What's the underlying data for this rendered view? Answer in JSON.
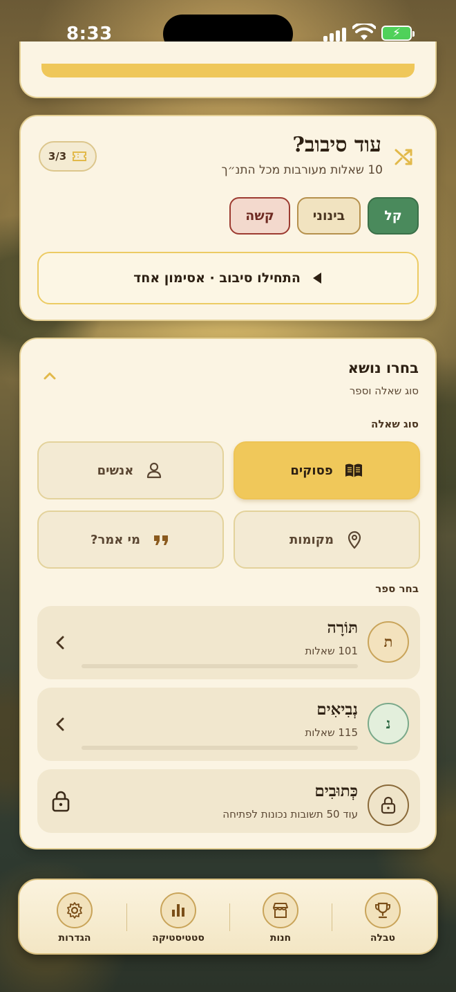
{
  "status_bar": {
    "time": "8:33"
  },
  "shuffle": {
    "title": "עוד סיבוב?",
    "subtitle": "10 שאלות מעורבות מכל התנ״ך",
    "tickets": "3/3",
    "difficulties": [
      {
        "label": "קל",
        "selected": true
      },
      {
        "label": "בינוני",
        "selected": false
      },
      {
        "label": "קשה",
        "selected": false
      }
    ],
    "start_label": "התחילו סיבוב · אסימון אחד"
  },
  "topic": {
    "title": "בחרו נושא",
    "subtitle": "סוג שאלה וספר",
    "qtype_label": "סוג שאלה",
    "qtypes": [
      {
        "label": "פסוקים",
        "icon": "book-open-icon",
        "selected": true
      },
      {
        "label": "אנשים",
        "icon": "person-icon",
        "selected": false
      },
      {
        "label": "מקומות",
        "icon": "map-pin-icon",
        "selected": false
      },
      {
        "label": "מי אמר?",
        "icon": "quote-icon",
        "selected": false
      }
    ],
    "book_label": "בחר ספר",
    "books": [
      {
        "letter": "ת",
        "name": "תּוֹרָה",
        "count": "101 שאלות",
        "progress": 0,
        "locked": false
      },
      {
        "letter": "נ",
        "name": "נְבִיאִים",
        "count": "115 שאלות",
        "progress": 0,
        "locked": false
      },
      {
        "letter": "",
        "name": "כְּתוּבִים",
        "count": "עוד 50 תשובות נכונות לפתיחה",
        "locked": true
      }
    ]
  },
  "tabbar": {
    "tabs": [
      {
        "label": "טבלה",
        "icon": "trophy-icon"
      },
      {
        "label": "חנות",
        "icon": "store-icon"
      },
      {
        "label": "סטטיסטיקה",
        "icon": "bar-chart-icon"
      },
      {
        "label": "הגדרות",
        "icon": "gear-icon"
      }
    ]
  },
  "colors": {
    "accent_gold": "#f0c85a",
    "easy_green": "#4a8a5c",
    "hard_red": "#9c3a30",
    "card_bg": "#fbf4e3"
  }
}
